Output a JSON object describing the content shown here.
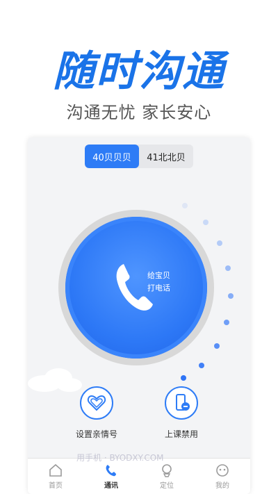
{
  "banner": {
    "title": "随时沟通",
    "subtitle": "沟通无忧 家长安心"
  },
  "device_tabs": [
    {
      "label": "40贝贝贝",
      "active": true
    },
    {
      "label": "41北北贝",
      "active": false
    }
  ],
  "call_button": {
    "line1": "给宝贝",
    "line2": "打电话"
  },
  "features": [
    {
      "label": "设置亲情号",
      "icon": "heart-icon"
    },
    {
      "label": "上课禁用",
      "icon": "phone-block-icon"
    }
  ],
  "tabbar": [
    {
      "label": "首页",
      "icon": "home-icon",
      "active": false
    },
    {
      "label": "通讯",
      "icon": "call-icon",
      "active": true
    },
    {
      "label": "定位",
      "icon": "location-icon",
      "active": false
    },
    {
      "label": "我的",
      "icon": "profile-icon",
      "active": false
    }
  ],
  "watermark": "用手机 · BYODXY.COM",
  "colors": {
    "accent": "#2e7cf6",
    "headline": "#1a73e8"
  }
}
